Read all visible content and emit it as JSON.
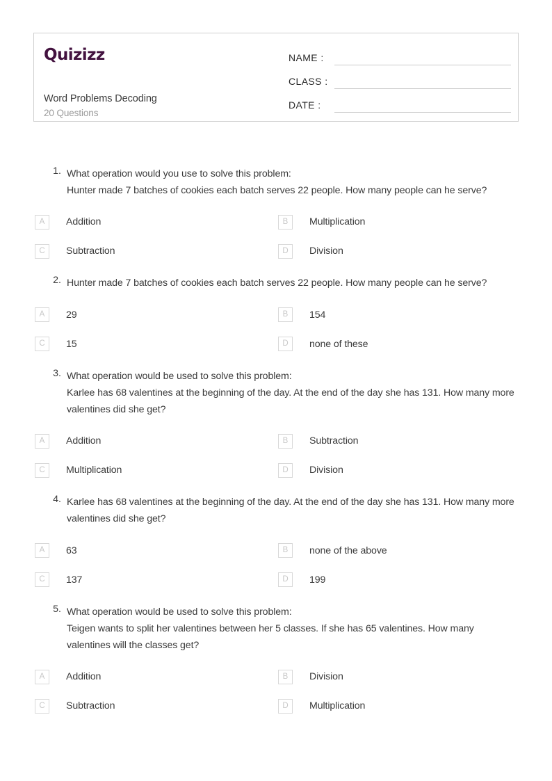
{
  "brand": {
    "logo_text": "Quizizz",
    "logo_color": "#43123f"
  },
  "header": {
    "title": "Word Problems Decoding",
    "subtitle": "20 Questions",
    "fields": [
      {
        "label": "NAME :",
        "value": ""
      },
      {
        "label": "CLASS :",
        "value": ""
      },
      {
        "label": "DATE  :",
        "value": ""
      }
    ]
  },
  "option_letters": [
    "A",
    "B",
    "C",
    "D"
  ],
  "questions": [
    {
      "number": "1.",
      "text": "What operation would you use to solve this problem:\nHunter made 7 batches of cookies each batch serves 22 people. How many people can he serve?",
      "options": [
        "Addition",
        "Multiplication",
        "Subtraction",
        "Division"
      ]
    },
    {
      "number": "2.",
      "text": "Hunter made 7 batches of cookies each batch serves 22 people. How many people can he serve?",
      "options": [
        "29",
        "154",
        "15",
        "none of these"
      ]
    },
    {
      "number": "3.",
      "text": "What operation would be used to solve this problem:\nKarlee has 68 valentines at the beginning of the day. At the end of the day she has 131. How many more valentines did she get?",
      "options": [
        "Addition",
        "Subtraction",
        "Multiplication",
        "Division"
      ]
    },
    {
      "number": "4.",
      "text": "Karlee has 68 valentines at the beginning of the day. At the end of the day she has 131. How many more valentines did she get?",
      "options": [
        "63",
        "none of the above",
        "137",
        "199"
      ]
    },
    {
      "number": "5.",
      "text": "What operation would be used to solve this problem:\nTeigen wants to split her valentines between her 5 classes. If she has 65 valentines. How many valentines will the classes get?",
      "options": [
        "Addition",
        "Division",
        "Subtraction",
        "Multiplication"
      ]
    }
  ]
}
